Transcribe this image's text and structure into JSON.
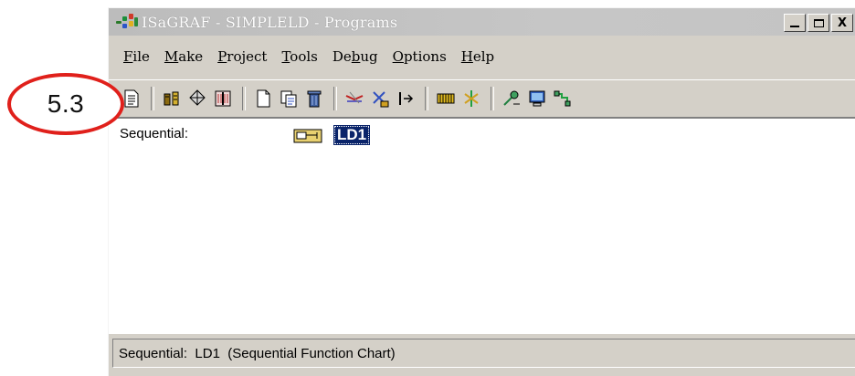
{
  "callout": {
    "label": "5.3",
    "color": "#e0201b"
  },
  "window": {
    "title": "ISaGRAF - SIMPLELD - Programs",
    "buttons": {
      "minimize": "_",
      "maximize": "□",
      "close": "X"
    }
  },
  "menu": [
    {
      "accel": "F",
      "rest": "ile"
    },
    {
      "accel": "M",
      "rest": "ake"
    },
    {
      "accel": "P",
      "rest": "roject"
    },
    {
      "accel": "T",
      "rest": "ools"
    },
    {
      "pre": "De",
      "accel": "b",
      "rest": "ug"
    },
    {
      "accel": "O",
      "rest": "ptions"
    },
    {
      "accel": "H",
      "rest": "elp"
    }
  ],
  "toolbar_icons": [
    "page-icon",
    "chart-icon",
    "network-icon",
    "book-icon",
    "new-file-icon",
    "copy-icon",
    "delete-icon",
    "compile-icon",
    "verify-icon",
    "arrow-icon",
    "io-icon",
    "signal-icon",
    "connect-icon",
    "monitor-icon",
    "link-icon"
  ],
  "content": {
    "section_label": "Sequential:",
    "program_name": "LD1"
  },
  "status": {
    "text": "Sequential:  LD1  (Sequential Function Chart)"
  },
  "colors": {
    "selection": "#0a246a",
    "chrome": "#d4d0c8"
  }
}
